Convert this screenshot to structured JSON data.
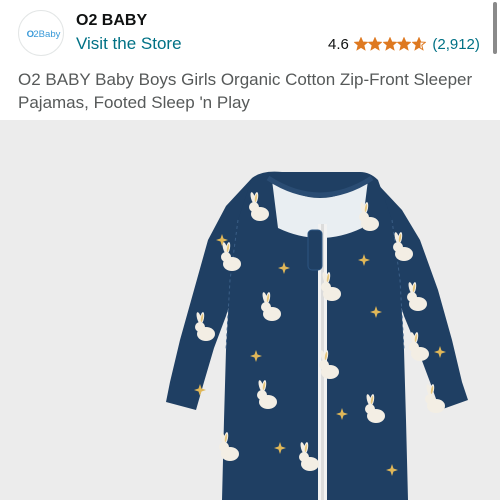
{
  "store": {
    "name": "O2 BABY",
    "logo_text": "O2Baby",
    "visit_link": "Visit the Store"
  },
  "rating": {
    "value": "4.6",
    "stars_value": 4.6,
    "stars_total": 5,
    "count": "(2,912)",
    "star_color": "#de7921"
  },
  "product": {
    "title": "O2 BABY Baby Boys Girls Organic Cotton Zip-Front Sleeper Pajamas, Footed Sleep 'n Play",
    "image_icon": "sleeper-pajamas-image",
    "fabric_color": "#1f3f63",
    "background_color": "#ececec"
  },
  "colors": {
    "link": "#007185",
    "text": "#0f1111",
    "muted_text": "#565959"
  }
}
